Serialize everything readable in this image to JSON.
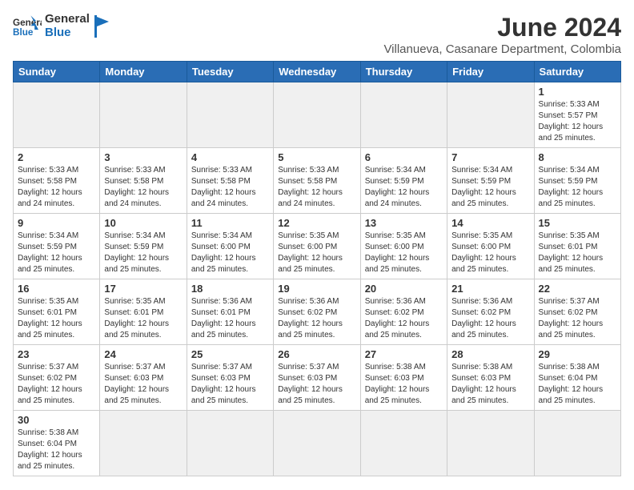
{
  "header": {
    "logo_general": "General",
    "logo_blue": "Blue",
    "month_year": "June 2024",
    "location": "Villanueva, Casanare Department, Colombia"
  },
  "days_of_week": [
    "Sunday",
    "Monday",
    "Tuesday",
    "Wednesday",
    "Thursday",
    "Friday",
    "Saturday"
  ],
  "weeks": [
    [
      {
        "day": "",
        "info": ""
      },
      {
        "day": "",
        "info": ""
      },
      {
        "day": "",
        "info": ""
      },
      {
        "day": "",
        "info": ""
      },
      {
        "day": "",
        "info": ""
      },
      {
        "day": "",
        "info": ""
      },
      {
        "day": "1",
        "info": "Sunrise: 5:33 AM\nSunset: 5:57 PM\nDaylight: 12 hours\nand 25 minutes."
      }
    ],
    [
      {
        "day": "2",
        "info": "Sunrise: 5:33 AM\nSunset: 5:58 PM\nDaylight: 12 hours\nand 24 minutes."
      },
      {
        "day": "3",
        "info": "Sunrise: 5:33 AM\nSunset: 5:58 PM\nDaylight: 12 hours\nand 24 minutes."
      },
      {
        "day": "4",
        "info": "Sunrise: 5:33 AM\nSunset: 5:58 PM\nDaylight: 12 hours\nand 24 minutes."
      },
      {
        "day": "5",
        "info": "Sunrise: 5:33 AM\nSunset: 5:58 PM\nDaylight: 12 hours\nand 24 minutes."
      },
      {
        "day": "6",
        "info": "Sunrise: 5:34 AM\nSunset: 5:59 PM\nDaylight: 12 hours\nand 24 minutes."
      },
      {
        "day": "7",
        "info": "Sunrise: 5:34 AM\nSunset: 5:59 PM\nDaylight: 12 hours\nand 25 minutes."
      },
      {
        "day": "8",
        "info": "Sunrise: 5:34 AM\nSunset: 5:59 PM\nDaylight: 12 hours\nand 25 minutes."
      }
    ],
    [
      {
        "day": "9",
        "info": "Sunrise: 5:34 AM\nSunset: 5:59 PM\nDaylight: 12 hours\nand 25 minutes."
      },
      {
        "day": "10",
        "info": "Sunrise: 5:34 AM\nSunset: 5:59 PM\nDaylight: 12 hours\nand 25 minutes."
      },
      {
        "day": "11",
        "info": "Sunrise: 5:34 AM\nSunset: 6:00 PM\nDaylight: 12 hours\nand 25 minutes."
      },
      {
        "day": "12",
        "info": "Sunrise: 5:35 AM\nSunset: 6:00 PM\nDaylight: 12 hours\nand 25 minutes."
      },
      {
        "day": "13",
        "info": "Sunrise: 5:35 AM\nSunset: 6:00 PM\nDaylight: 12 hours\nand 25 minutes."
      },
      {
        "day": "14",
        "info": "Sunrise: 5:35 AM\nSunset: 6:00 PM\nDaylight: 12 hours\nand 25 minutes."
      },
      {
        "day": "15",
        "info": "Sunrise: 5:35 AM\nSunset: 6:01 PM\nDaylight: 12 hours\nand 25 minutes."
      }
    ],
    [
      {
        "day": "16",
        "info": "Sunrise: 5:35 AM\nSunset: 6:01 PM\nDaylight: 12 hours\nand 25 minutes."
      },
      {
        "day": "17",
        "info": "Sunrise: 5:35 AM\nSunset: 6:01 PM\nDaylight: 12 hours\nand 25 minutes."
      },
      {
        "day": "18",
        "info": "Sunrise: 5:36 AM\nSunset: 6:01 PM\nDaylight: 12 hours\nand 25 minutes."
      },
      {
        "day": "19",
        "info": "Sunrise: 5:36 AM\nSunset: 6:02 PM\nDaylight: 12 hours\nand 25 minutes."
      },
      {
        "day": "20",
        "info": "Sunrise: 5:36 AM\nSunset: 6:02 PM\nDaylight: 12 hours\nand 25 minutes."
      },
      {
        "day": "21",
        "info": "Sunrise: 5:36 AM\nSunset: 6:02 PM\nDaylight: 12 hours\nand 25 minutes."
      },
      {
        "day": "22",
        "info": "Sunrise: 5:37 AM\nSunset: 6:02 PM\nDaylight: 12 hours\nand 25 minutes."
      }
    ],
    [
      {
        "day": "23",
        "info": "Sunrise: 5:37 AM\nSunset: 6:02 PM\nDaylight: 12 hours\nand 25 minutes."
      },
      {
        "day": "24",
        "info": "Sunrise: 5:37 AM\nSunset: 6:03 PM\nDaylight: 12 hours\nand 25 minutes."
      },
      {
        "day": "25",
        "info": "Sunrise: 5:37 AM\nSunset: 6:03 PM\nDaylight: 12 hours\nand 25 minutes."
      },
      {
        "day": "26",
        "info": "Sunrise: 5:37 AM\nSunset: 6:03 PM\nDaylight: 12 hours\nand 25 minutes."
      },
      {
        "day": "27",
        "info": "Sunrise: 5:38 AM\nSunset: 6:03 PM\nDaylight: 12 hours\nand 25 minutes."
      },
      {
        "day": "28",
        "info": "Sunrise: 5:38 AM\nSunset: 6:03 PM\nDaylight: 12 hours\nand 25 minutes."
      },
      {
        "day": "29",
        "info": "Sunrise: 5:38 AM\nSunset: 6:04 PM\nDaylight: 12 hours\nand 25 minutes."
      }
    ],
    [
      {
        "day": "30",
        "info": "Sunrise: 5:38 AM\nSunset: 6:04 PM\nDaylight: 12 hours\nand 25 minutes."
      },
      {
        "day": "",
        "info": ""
      },
      {
        "day": "",
        "info": ""
      },
      {
        "day": "",
        "info": ""
      },
      {
        "day": "",
        "info": ""
      },
      {
        "day": "",
        "info": ""
      },
      {
        "day": "",
        "info": ""
      }
    ]
  ]
}
